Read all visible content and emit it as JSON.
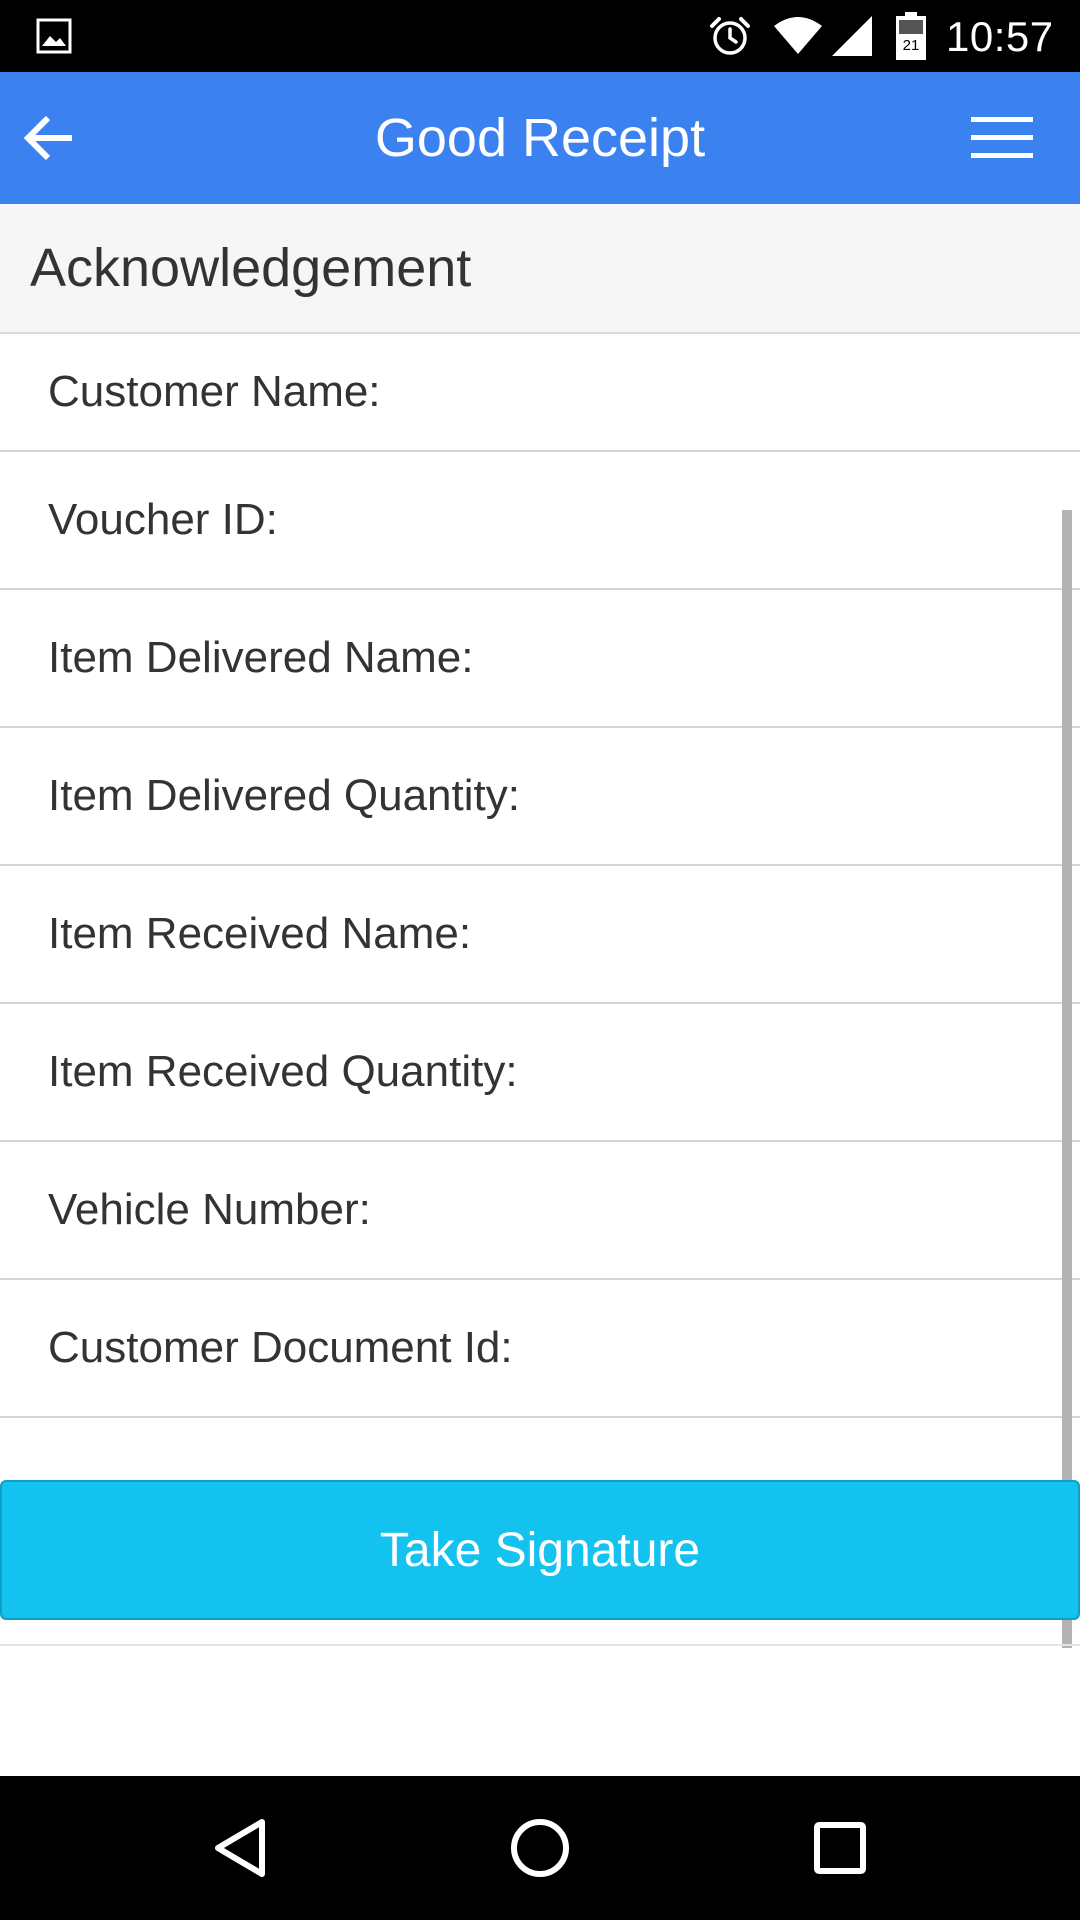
{
  "status_bar": {
    "time": "10:57",
    "battery_level": "21",
    "icons": [
      "gallery-icon",
      "alarm-icon",
      "wifi-icon",
      "cell-signal-icon",
      "battery-icon"
    ]
  },
  "app_bar": {
    "title": "Good Receipt",
    "back_icon": "arrow-left-icon",
    "menu_icon": "hamburger-menu-icon",
    "background_color": "#3b82f0"
  },
  "section": {
    "title": "Acknowledgement"
  },
  "fields": [
    {
      "label": "Customer Name:"
    },
    {
      "label": "Voucher ID:"
    },
    {
      "label": "Item Delivered Name:"
    },
    {
      "label": "Item Delivered Quantity:"
    },
    {
      "label": "Item Received Name:"
    },
    {
      "label": "Item Received Quantity:"
    },
    {
      "label": "Vehicle Number:"
    },
    {
      "label": "Customer Document Id:"
    }
  ],
  "actions": {
    "take_signature_label": "Take Signature",
    "take_signature_color": "#13c2ef"
  },
  "nav_bar": {
    "icons": [
      "back-triangle-icon",
      "home-circle-icon",
      "recents-square-icon"
    ]
  }
}
